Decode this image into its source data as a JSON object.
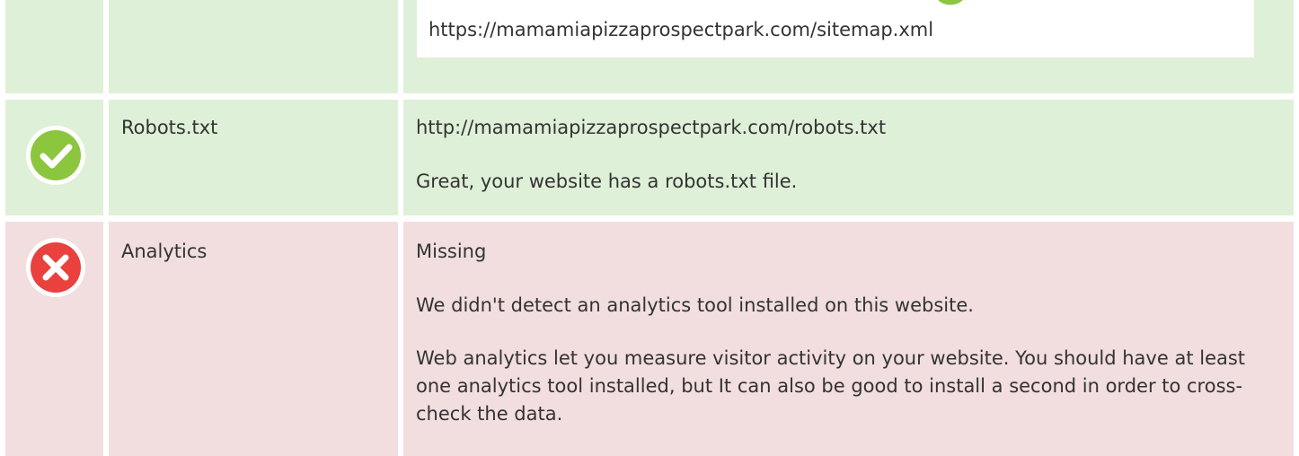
{
  "rows": [
    {
      "status": "pass",
      "label": "",
      "sitemap_url": "https://mamamiapizzaprospectpark.com/sitemap.xml"
    },
    {
      "status": "pass",
      "label": "Robots.txt",
      "value": "http://mamamiapizzaprospectpark.com/robots.txt",
      "message": "Great, your website has a robots.txt file."
    },
    {
      "status": "fail",
      "label": "Analytics",
      "value": "Missing",
      "message": "We didn't detect an analytics tool installed on this website.",
      "advice": "Web analytics let you measure visitor activity on your website. You should have at least one analytics tool installed, but It can also be good to install a second in order to cross-check the data."
    }
  ],
  "icons": {
    "pass": "check-circle-icon",
    "fail": "x-circle-icon"
  },
  "colors": {
    "pass_bg": "#dff0d8",
    "fail_bg": "#f2dede",
    "pass_icon": "#8cc63e",
    "fail_icon": "#e8413e",
    "text": "#333333"
  }
}
